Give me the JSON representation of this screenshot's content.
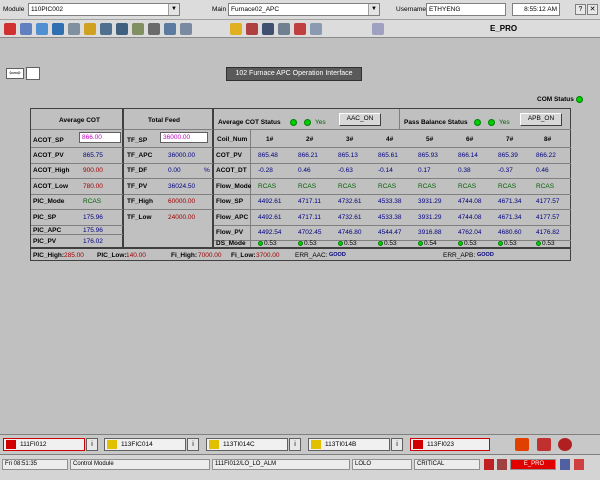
{
  "header": {
    "module_label": "Module",
    "module_value": "110PIC002",
    "main_label": "Main",
    "main_value": "Furnace02_APC",
    "username_label": "Username",
    "username_value": "ETHYENG",
    "time": "8:55:12 AM",
    "system_name": "E_PRO"
  },
  "screen": {
    "title": "102 Furnace APC Operation Interface",
    "com_status_label": "COM Status",
    "nav_arrows": "⇦⇨"
  },
  "avg_cot": {
    "title": "Average  COT",
    "rows": [
      {
        "label": "ACOT_SP",
        "value": "866.00"
      },
      {
        "label": "ACOT_PV",
        "value": "865.75"
      },
      {
        "label": "ACOT_High",
        "value": "900.00"
      },
      {
        "label": "ACOT_Low",
        "value": "780.00"
      },
      {
        "label": "PIC_Mode",
        "value": "RCAS"
      },
      {
        "label": "PIC_SP",
        "value": "175.96"
      },
      {
        "label": "PIC_APC",
        "value": "175.96"
      },
      {
        "label": "PIC_PV",
        "value": "176.02"
      }
    ]
  },
  "total_feed": {
    "title": "Total  Feed",
    "rows": [
      {
        "label": "TF_SP",
        "value": "36000.00"
      },
      {
        "label": "TF_APC",
        "value": "36000.00"
      },
      {
        "label": "TF_DF",
        "value": "0.00",
        "unit": "%"
      },
      {
        "label": "TF_PV",
        "value": "36024.50"
      },
      {
        "label": "TF_High",
        "value": "60000.00"
      },
      {
        "label": "TF_Low",
        "value": "24000.00"
      }
    ]
  },
  "status_bar_row": {
    "acot_status_label": "Average  COT Status",
    "yes1": "Yes",
    "aac_on": "AAC_ON",
    "pass_balance_label": "Pass Balance Status",
    "yes2": "Yes",
    "apb_on": "APB_ON"
  },
  "coils": {
    "header_label": "Coil_Num",
    "columns": [
      "1#",
      "2#",
      "3#",
      "4#",
      "5#",
      "6#",
      "7#",
      "8#"
    ],
    "rows": [
      {
        "label": "COT_PV",
        "values": [
          "865.48",
          "866.21",
          "865.13",
          "865.61",
          "865.93",
          "866.14",
          "865.39",
          "866.22"
        ]
      },
      {
        "label": "ACOT_DT",
        "values": [
          "-0.28",
          "0.46",
          "-0.63",
          "-0.14",
          "0.17",
          "0.38",
          "-0.37",
          "0.46"
        ]
      },
      {
        "label": "Flow_Mode",
        "values": [
          "RCAS",
          "RCAS",
          "RCAS",
          "RCAS",
          "RCAS",
          "RCAS",
          "RCAS",
          "RCAS"
        ]
      },
      {
        "label": "Flow_SP",
        "values": [
          "4492.61",
          "4717.11",
          "4732.61",
          "4533.38",
          "3931.29",
          "4744.08",
          "4671.34",
          "4177.57"
        ]
      },
      {
        "label": "Flow_APC",
        "values": [
          "4492.61",
          "4717.11",
          "4732.61",
          "4533.38",
          "3931.29",
          "4744.08",
          "4671.34",
          "4177.57"
        ]
      },
      {
        "label": "Flow_PV",
        "values": [
          "4492.54",
          "4702.45",
          "4746.80",
          "4544.47",
          "3916.88",
          "4762.04",
          "4680.60",
          "4176.82"
        ]
      },
      {
        "label": "DS_Mode",
        "values": [
          "0.53",
          "0.53",
          "0.53",
          "0.53",
          "0.54",
          "0.53",
          "0.53",
          "0.53"
        ]
      }
    ]
  },
  "limits": {
    "pic_high_label": "PIC_High:",
    "pic_high": "285.00",
    "pic_low_label": "PIC_Low:",
    "pic_low": "140.00",
    "fi_high_label": "Fi_High:",
    "fi_high": "7000.00",
    "fi_low_label": "Fi_Low:",
    "fi_low": "3700.00",
    "err_aac_label": "ERR_AAC:",
    "err_aac": "GOOD",
    "err_apb_label": "ERR_APB:",
    "err_apb": "GOOD"
  },
  "alarms": [
    {
      "tag": "111FI012",
      "color": "#d00000"
    },
    {
      "tag": "113FIC014",
      "color": "#e0c000"
    },
    {
      "tag": "113TI014C",
      "color": "#e0c000"
    },
    {
      "tag": "113TI014B",
      "color": "#e0c000"
    },
    {
      "tag": "113FI023",
      "color": "#d00000"
    }
  ],
  "alarm_info_glyph": "i",
  "statusbar": {
    "time": "Fri 08:51:35",
    "type": "Control Module",
    "alarm_desc": "111FI012/LO_LO_ALM",
    "level": "LOLO",
    "priority": "CRITICAL",
    "system": "E_PRO"
  }
}
